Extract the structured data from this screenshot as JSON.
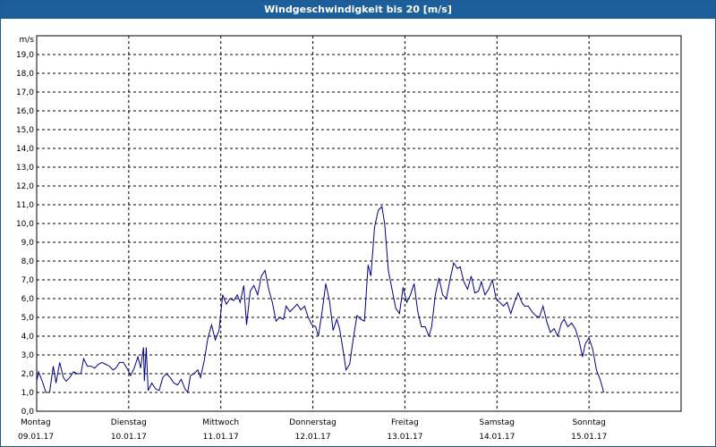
{
  "window": {
    "title": "Windgeschwindigkeit bis 20 [m/s]"
  },
  "colors": {
    "title_bg": "#1c5f9b",
    "line": "#00008b",
    "grid": "#000000"
  },
  "chart_data": {
    "type": "line",
    "title": "Windgeschwindigkeit bis 20 [m/s]",
    "ylabel": "m/s",
    "ylim": [
      0,
      20
    ],
    "xlim": [
      0,
      7
    ],
    "grid": true,
    "y_ticks": [
      "0,0",
      "1,0",
      "2,0",
      "3,0",
      "4,0",
      "5,0",
      "6,0",
      "7,0",
      "8,0",
      "9,0",
      "10,0",
      "11,0",
      "12,0",
      "13,0",
      "14,0",
      "15,0",
      "16,0",
      "17,0",
      "18,0",
      "19,0"
    ],
    "x_ticks": [
      {
        "day": "Montag",
        "date": "09.01.17"
      },
      {
        "day": "Dienstag",
        "date": "10.01.17"
      },
      {
        "day": "Mittwoch",
        "date": "11.01.17"
      },
      {
        "day": "Donnerstag",
        "date": "12.01.17"
      },
      {
        "day": "Freitag",
        "date": "13.01.17"
      },
      {
        "day": "Samstag",
        "date": "14.01.17"
      },
      {
        "day": "Sonntag",
        "date": "15.01.17"
      }
    ],
    "series": [
      {
        "values": [
          [
            0.0,
            1.6
          ],
          [
            0.02,
            2.1
          ],
          [
            0.06,
            1.6
          ],
          [
            0.1,
            1.0
          ],
          [
            0.14,
            1.0
          ],
          [
            0.18,
            2.4
          ],
          [
            0.21,
            1.5
          ],
          [
            0.25,
            2.6
          ],
          [
            0.29,
            1.8
          ],
          [
            0.32,
            1.6
          ],
          [
            0.36,
            1.8
          ],
          [
            0.4,
            2.1
          ],
          [
            0.44,
            2.0
          ],
          [
            0.48,
            2.0
          ],
          [
            0.51,
            2.8
          ],
          [
            0.55,
            2.4
          ],
          [
            0.59,
            2.4
          ],
          [
            0.63,
            2.3
          ],
          [
            0.67,
            2.5
          ],
          [
            0.71,
            2.6
          ],
          [
            0.75,
            2.5
          ],
          [
            0.79,
            2.4
          ],
          [
            0.83,
            2.2
          ],
          [
            0.86,
            2.3
          ],
          [
            0.9,
            2.6
          ],
          [
            0.94,
            2.6
          ],
          [
            0.98,
            2.3
          ],
          [
            1.02,
            1.9
          ],
          [
            1.06,
            2.3
          ],
          [
            1.1,
            2.9
          ],
          [
            1.13,
            2.3
          ],
          [
            1.16,
            3.4
          ],
          [
            1.17,
            1.6
          ],
          [
            1.19,
            3.4
          ],
          [
            1.21,
            1.1
          ],
          [
            1.25,
            1.5
          ],
          [
            1.29,
            1.2
          ],
          [
            1.33,
            1.1
          ],
          [
            1.37,
            1.8
          ],
          [
            1.41,
            2.0
          ],
          [
            1.45,
            1.8
          ],
          [
            1.49,
            1.5
          ],
          [
            1.53,
            1.4
          ],
          [
            1.57,
            1.7
          ],
          [
            1.61,
            1.2
          ],
          [
            1.64,
            1.0
          ],
          [
            1.67,
            1.9
          ],
          [
            1.71,
            2.0
          ],
          [
            1.75,
            2.2
          ],
          [
            1.78,
            1.8
          ],
          [
            1.82,
            2.7
          ],
          [
            1.86,
            3.9
          ],
          [
            1.9,
            4.6
          ],
          [
            1.94,
            3.8
          ],
          [
            1.98,
            4.3
          ],
          [
            2.02,
            6.2
          ],
          [
            2.06,
            5.7
          ],
          [
            2.1,
            6.0
          ],
          [
            2.14,
            5.9
          ],
          [
            2.18,
            6.2
          ],
          [
            2.21,
            5.8
          ],
          [
            2.25,
            6.7
          ],
          [
            2.28,
            4.6
          ],
          [
            2.32,
            6.4
          ],
          [
            2.36,
            6.7
          ],
          [
            2.4,
            6.2
          ],
          [
            2.44,
            7.2
          ],
          [
            2.48,
            7.5
          ],
          [
            2.52,
            6.5
          ],
          [
            2.56,
            5.8
          ],
          [
            2.6,
            4.8
          ],
          [
            2.64,
            5.0
          ],
          [
            2.68,
            4.9
          ],
          [
            2.71,
            5.6
          ],
          [
            2.75,
            5.3
          ],
          [
            2.79,
            5.5
          ],
          [
            2.83,
            5.7
          ],
          [
            2.87,
            5.4
          ],
          [
            2.91,
            5.6
          ],
          [
            2.95,
            5.0
          ],
          [
            2.99,
            4.6
          ],
          [
            3.03,
            4.5
          ],
          [
            3.06,
            4.0
          ],
          [
            3.1,
            5.3
          ],
          [
            3.14,
            6.8
          ],
          [
            3.18,
            5.9
          ],
          [
            3.22,
            4.3
          ],
          [
            3.26,
            4.9
          ],
          [
            3.29,
            4.4
          ],
          [
            3.33,
            3.2
          ],
          [
            3.36,
            2.2
          ],
          [
            3.4,
            2.5
          ],
          [
            3.44,
            3.9
          ],
          [
            3.48,
            5.1
          ],
          [
            3.52,
            4.9
          ],
          [
            3.56,
            4.8
          ],
          [
            3.6,
            7.8
          ],
          [
            3.63,
            7.2
          ],
          [
            3.67,
            9.8
          ],
          [
            3.71,
            10.7
          ],
          [
            3.75,
            10.9
          ],
          [
            3.78,
            10.0
          ],
          [
            3.82,
            7.5
          ],
          [
            3.86,
            6.5
          ],
          [
            3.9,
            5.5
          ],
          [
            3.94,
            5.2
          ],
          [
            3.98,
            6.6
          ],
          [
            4.02,
            5.8
          ],
          [
            4.06,
            6.2
          ],
          [
            4.1,
            6.8
          ],
          [
            4.14,
            5.3
          ],
          [
            4.18,
            4.5
          ],
          [
            4.22,
            4.5
          ],
          [
            4.26,
            4.0
          ],
          [
            4.29,
            4.5
          ],
          [
            4.33,
            6.2
          ],
          [
            4.37,
            7.1
          ],
          [
            4.41,
            6.2
          ],
          [
            4.45,
            6.0
          ],
          [
            4.49,
            7.0
          ],
          [
            4.53,
            7.9
          ],
          [
            4.57,
            7.6
          ],
          [
            4.6,
            7.7
          ],
          [
            4.64,
            6.9
          ],
          [
            4.68,
            6.5
          ],
          [
            4.72,
            7.2
          ],
          [
            4.76,
            6.3
          ],
          [
            4.8,
            6.4
          ],
          [
            4.83,
            6.9
          ],
          [
            4.87,
            6.2
          ],
          [
            4.91,
            6.5
          ],
          [
            4.95,
            7.0
          ],
          [
            4.99,
            6.0
          ],
          [
            5.03,
            5.8
          ],
          [
            5.07,
            5.6
          ],
          [
            5.11,
            5.8
          ],
          [
            5.15,
            5.2
          ],
          [
            5.19,
            5.8
          ],
          [
            5.23,
            6.3
          ],
          [
            5.27,
            5.8
          ],
          [
            5.3,
            5.6
          ],
          [
            5.34,
            5.6
          ],
          [
            5.38,
            5.3
          ],
          [
            5.42,
            5.1
          ],
          [
            5.46,
            5.0
          ],
          [
            5.5,
            5.6
          ],
          [
            5.54,
            4.8
          ],
          [
            5.58,
            4.2
          ],
          [
            5.62,
            4.4
          ],
          [
            5.66,
            4.0
          ],
          [
            5.7,
            4.7
          ],
          [
            5.73,
            4.9
          ],
          [
            5.77,
            4.5
          ],
          [
            5.81,
            4.7
          ],
          [
            5.85,
            4.4
          ],
          [
            5.89,
            3.8
          ],
          [
            5.93,
            2.9
          ],
          [
            5.96,
            3.6
          ],
          [
            6.0,
            3.9
          ],
          [
            6.04,
            3.3
          ],
          [
            6.08,
            2.2
          ],
          [
            6.12,
            1.7
          ],
          [
            6.16,
            1.0
          ]
        ]
      }
    ]
  }
}
